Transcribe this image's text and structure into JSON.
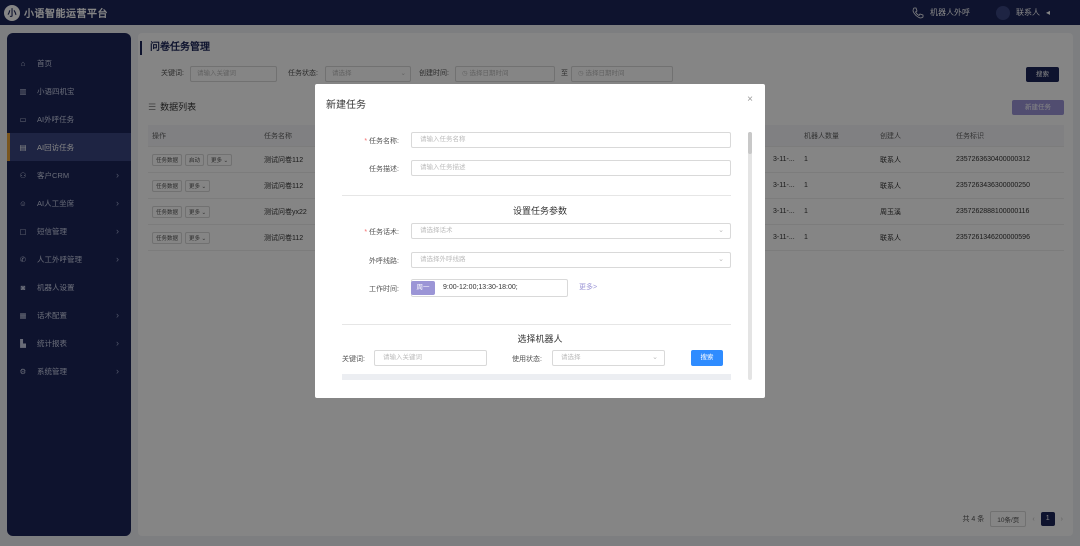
{
  "topbar": {
    "logo_glyph": "小",
    "app_title": "小语智能运营平台",
    "outbound_label": "机器人外呼",
    "contact_label": "联系人",
    "contact_caret": "◂"
  },
  "sidebar": {
    "items": [
      {
        "label": "首页",
        "icon": "home-icon",
        "arrow": ""
      },
      {
        "label": "小语四机宝",
        "icon": "bars-icon",
        "arrow": ""
      },
      {
        "label": "AI外呼任务",
        "icon": "card-icon",
        "arrow": ""
      },
      {
        "label": "AI回访任务",
        "icon": "form-icon",
        "arrow": "",
        "active": true
      },
      {
        "label": "客户CRM",
        "icon": "user-icon",
        "arrow": "›"
      },
      {
        "label": "AI人工坐席",
        "icon": "agent-icon",
        "arrow": "›"
      },
      {
        "label": "短信管理",
        "icon": "message-icon",
        "arrow": "›"
      },
      {
        "label": "人工外呼管理",
        "icon": "phone-icon",
        "arrow": "›"
      },
      {
        "label": "机器人设置",
        "icon": "robot-icon",
        "arrow": ""
      },
      {
        "label": "话术配置",
        "icon": "script-icon",
        "arrow": "›"
      },
      {
        "label": "统计报表",
        "icon": "chart-icon",
        "arrow": "›"
      },
      {
        "label": "系统管理",
        "icon": "gear-icon",
        "arrow": "›"
      }
    ]
  },
  "main": {
    "title": "问卷任务管理",
    "filter": {
      "keyword_label": "关键词:",
      "keyword_placeholder": "请输入关键词",
      "status_label": "任务状态:",
      "status_placeholder": "请选择",
      "created_label": "创建时间:",
      "date_start_placeholder": "选择日期时间",
      "to_label": "至",
      "date_end_placeholder": "选择日期时间",
      "search_button": "搜索"
    },
    "list_title": "数据列表",
    "new_task_button": "新建任务",
    "table": {
      "headers": {
        "op": "操作",
        "name": "任务名称",
        "count": "机器人数量",
        "creator": "创建人",
        "id": "任务标识"
      },
      "rows": [
        {
          "ops": [
            "任务数据",
            "启动",
            "更多 ⌄"
          ],
          "name": "测试问卷112",
          "date": "3-11-...",
          "count": "1",
          "creator": "联系人",
          "id": "2357263630400000312"
        },
        {
          "ops": [
            "任务数据",
            "更多 ⌄"
          ],
          "name": "测试问卷112",
          "date": "3-11-...",
          "count": "1",
          "creator": "联系人",
          "id": "2357263436300000250"
        },
        {
          "ops": [
            "任务数据",
            "更多 ⌄"
          ],
          "name": "测试问卷yx22",
          "date": "3-11-...",
          "count": "1",
          "creator": "周玉溪",
          "id": "2357262888100000116"
        },
        {
          "ops": [
            "任务数据",
            "更多 ⌄"
          ],
          "name": "测试问卷112",
          "date": "3-11-...",
          "count": "1",
          "creator": "联系人",
          "id": "2357261346200000596"
        }
      ]
    },
    "pager": {
      "total": "共 4 条",
      "page_size": "10条/页",
      "prev": "‹",
      "current": "1",
      "next": "›"
    }
  },
  "modal": {
    "title": "新建任务",
    "close": "×",
    "name_label": "任务名称:",
    "name_placeholder": "请输入任务名称",
    "desc_label": "任务描述:",
    "desc_placeholder": "请输入任务描述",
    "params_section": "设置任务参数",
    "script_label": "任务话术:",
    "script_placeholder": "请选择话术",
    "line_label": "外呼线路:",
    "line_placeholder": "请选择外呼线路",
    "worktime_label": "工作时间:",
    "worktime_day": "周一",
    "worktime_value": "9:00-12:00;13:30-18:00;",
    "more_link": "更多>",
    "robot_section": "选择机器人",
    "keyword_label": "关键词:",
    "keyword_placeholder": "请输入关键词",
    "status_label": "使用状态:",
    "status_placeholder": "请选择",
    "search_button": "搜索"
  }
}
